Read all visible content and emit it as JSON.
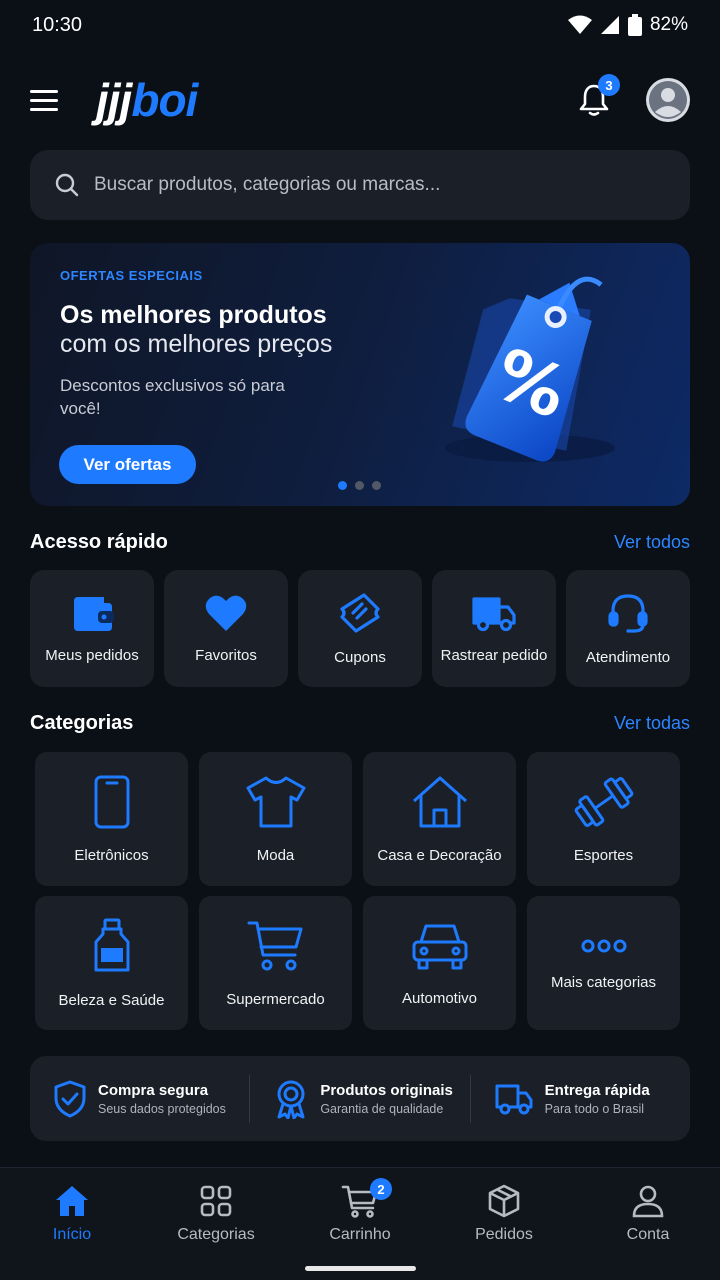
{
  "status": {
    "time": "10:30",
    "battery": "82%"
  },
  "header": {
    "logo_part1": "jjj",
    "logo_part2": "boi",
    "notifications_count": "3"
  },
  "search": {
    "placeholder": "Buscar produtos, categorias ou marcas..."
  },
  "banner": {
    "eyebrow": "OFERTAS ESPECIAIS",
    "title": "Os melhores produtos",
    "subtitle": "com os melhores preços",
    "description": "Descontos exclusivos só para você!",
    "button": "Ver ofertas",
    "slide_count": 3,
    "active_slide": 1
  },
  "quick_access": {
    "title": "Acesso rápido",
    "link": "Ver todos",
    "items": [
      {
        "label": "Meus pedidos",
        "icon": "wallet-icon"
      },
      {
        "label": "Favoritos",
        "icon": "heart-icon"
      },
      {
        "label": "Cupons",
        "icon": "ticket-icon"
      },
      {
        "label": "Rastrear pedido",
        "icon": "truck-icon"
      },
      {
        "label": "Atendimento",
        "icon": "headset-icon"
      }
    ]
  },
  "categories": {
    "title": "Categorias",
    "link": "Ver todas",
    "items": [
      {
        "label": "Eletrônicos",
        "icon": "smartphone-icon"
      },
      {
        "label": "Moda",
        "icon": "tshirt-icon"
      },
      {
        "label": "Casa e Decoração",
        "icon": "house-icon"
      },
      {
        "label": "Esportes",
        "icon": "dumbbell-icon"
      },
      {
        "label": "Beleza e Saúde",
        "icon": "bottle-icon"
      },
      {
        "label": "Supermercado",
        "icon": "cart-icon"
      },
      {
        "label": "Automotivo",
        "icon": "car-icon"
      },
      {
        "label": "Mais categorias",
        "icon": "more-icon"
      }
    ]
  },
  "trust": [
    {
      "title": "Compra segura",
      "subtitle": "Seus dados protegidos",
      "icon": "shield-check-icon"
    },
    {
      "title": "Produtos originais",
      "subtitle": "Garantia de qualidade",
      "icon": "medal-icon"
    },
    {
      "title": "Entrega rápida",
      "subtitle": "Para todo o Brasil",
      "icon": "truck-icon"
    }
  ],
  "bottom_nav": {
    "items": [
      {
        "label": "Início",
        "icon": "home-icon",
        "active": true
      },
      {
        "label": "Categorias",
        "icon": "grid-icon"
      },
      {
        "label": "Carrinho",
        "icon": "cart-icon",
        "badge": "2"
      },
      {
        "label": "Pedidos",
        "icon": "package-icon"
      },
      {
        "label": "Conta",
        "icon": "user-icon"
      }
    ]
  },
  "colors": {
    "accent": "#1e7bff",
    "background": "#0b0f16",
    "card": "#1b1f27"
  }
}
